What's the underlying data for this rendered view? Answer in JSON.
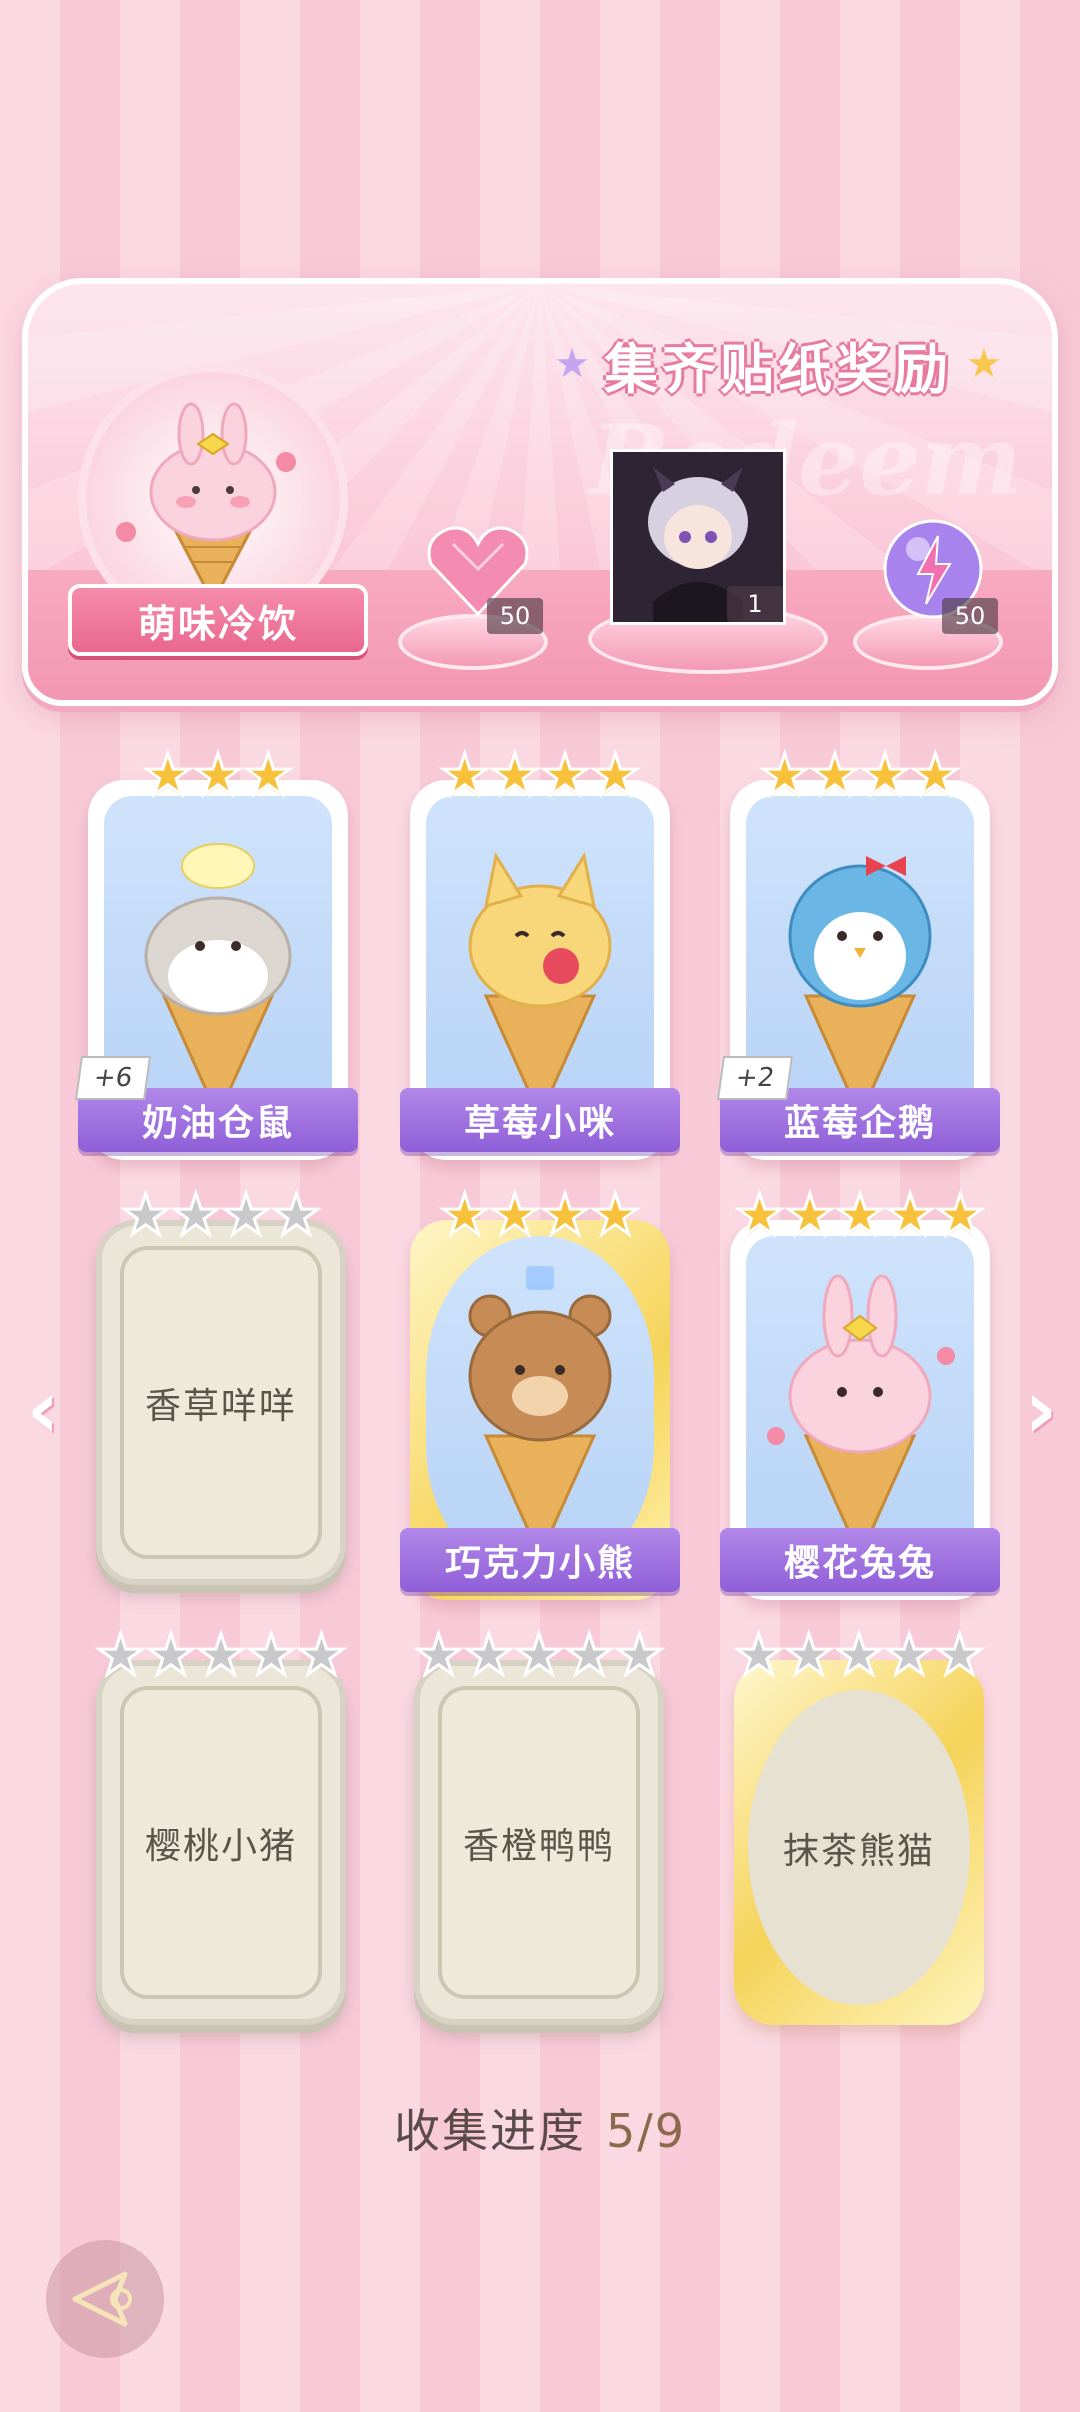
{
  "banner": {
    "title": "集齐贴纸奖励",
    "watermark": "Redeem",
    "set_name": "萌味冷饮",
    "rewards": [
      {
        "icon": "pink-heart-gem-icon",
        "count": "50"
      },
      {
        "icon": "character-portrait-icon",
        "count": "1"
      },
      {
        "icon": "purple-energy-orb-icon",
        "count": "50"
      }
    ]
  },
  "cards": [
    {
      "name": "奶油仓鼠",
      "stars": 3,
      "unlocked": true,
      "extra": "+6"
    },
    {
      "name": "草莓小咪",
      "stars": 4,
      "unlocked": true,
      "extra": ""
    },
    {
      "name": "蓝莓企鹅",
      "stars": 4,
      "unlocked": true,
      "extra": "+2"
    },
    {
      "name": "香草咩咩",
      "stars": 4,
      "unlocked": false,
      "extra": ""
    },
    {
      "name": "巧克力小熊",
      "stars": 4,
      "unlocked": true,
      "extra": ""
    },
    {
      "name": "樱花兔兔",
      "stars": 5,
      "unlocked": true,
      "extra": ""
    },
    {
      "name": "樱桃小猪",
      "stars": 5,
      "unlocked": false,
      "extra": ""
    },
    {
      "name": "香橙鸭鸭",
      "stars": 5,
      "unlocked": false,
      "extra": ""
    },
    {
      "name": "抹茶熊猫",
      "stars": 5,
      "unlocked": false,
      "extra": ""
    }
  ],
  "progress": {
    "label": "收集进度",
    "value": "5/9",
    "collected": 5,
    "total": 9
  },
  "colors": {
    "accent_pink": "#f58cab",
    "label_purple": "#8f5fd8",
    "star_gold": "#f7c13c"
  }
}
